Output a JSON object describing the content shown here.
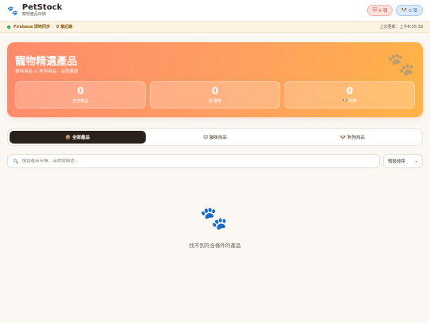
{
  "header": {
    "brand_title": "PetStock",
    "brand_subtitle": "寵物產品目錄",
    "cat_pill": "0 項",
    "dog_pill": "0 項"
  },
  "sync": {
    "status": "Firebase 即時同步",
    "separator": "·",
    "count": "0 筆記錄",
    "last_updated": "上次更新：上午8:35:39"
  },
  "hero": {
    "title": "寵物精選產品",
    "subtitle": "貓咪用品 & 狗狗用品・品質嚴選",
    "stats": [
      {
        "value": "0",
        "label": "全部產品"
      },
      {
        "value": "0",
        "label": "🐱 貓咪"
      },
      {
        "value": "0",
        "label": "🐶 狗狗"
      }
    ]
  },
  "tabs": [
    {
      "label": "📦 全部產品",
      "active": true
    },
    {
      "label": "🐱 貓咪用品",
      "active": false
    },
    {
      "label": "🐶 狗狗用品",
      "active": false
    }
  ],
  "search": {
    "placeholder": "搜尋產品名稱、品牌或描述...",
    "value": ""
  },
  "sort": {
    "selected": "預設排序"
  },
  "empty": {
    "message": "找不到符合條件的產品"
  },
  "icons": {
    "logo": "paw-icon",
    "search": "search-icon",
    "empty": "paw-icon"
  },
  "colors": {
    "accent": "#ff9966",
    "cat": "#c8503c",
    "dog": "#3268a8",
    "sync_ok": "#2fae5a"
  }
}
